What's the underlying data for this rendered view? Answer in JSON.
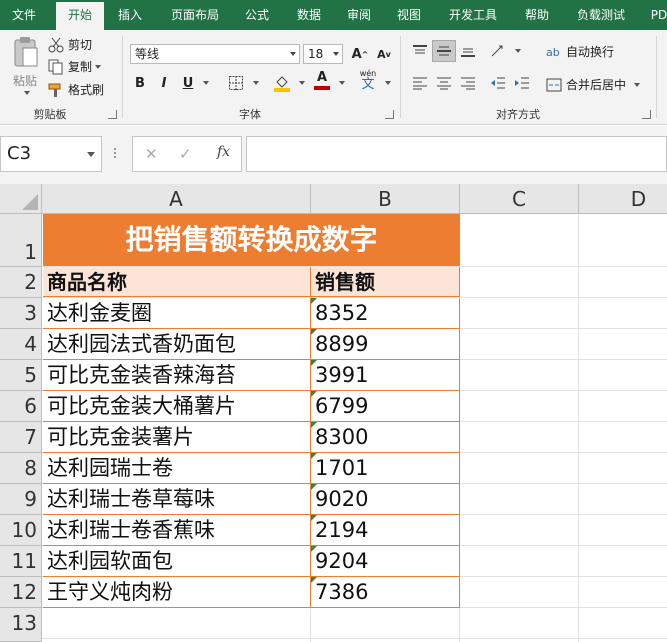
{
  "menu": {
    "tabs": [
      "文件",
      "开始",
      "插入",
      "页面布局",
      "公式",
      "数据",
      "审阅",
      "视图",
      "开发工具",
      "帮助",
      "负载测试",
      "PD"
    ],
    "active_tab": "开始"
  },
  "ribbon": {
    "clipboard": {
      "paste_label": "粘贴",
      "cut_label": "剪切",
      "copy_label": "复制",
      "format_painter_label": "格式刷",
      "group_label": "剪贴板"
    },
    "font": {
      "font_name": "等线",
      "font_size": "18",
      "increase_label": "A",
      "decrease_label": "A",
      "bold": "B",
      "italic": "I",
      "underline": "U",
      "font_color_label": "A",
      "wen_label": "wén",
      "wen_char": "文",
      "group_label": "字体"
    },
    "alignment": {
      "wrap_text_label": "自动换行",
      "merge_center_label": "合并后居中",
      "group_label": "对齐方式"
    }
  },
  "formula_bar": {
    "name_box": "C3",
    "cancel_symbol": "✕",
    "enter_symbol": "✓",
    "fx_symbol": "fx",
    "formula_value": ""
  },
  "sheet": {
    "columns": [
      "A",
      "B",
      "C",
      "D"
    ],
    "row_numbers": [
      "1",
      "2",
      "3",
      "4",
      "5",
      "6",
      "7",
      "8",
      "9",
      "10",
      "11",
      "12",
      "13"
    ],
    "title": "把销售额转换成数字",
    "header": {
      "name": "商品名称",
      "sales": "销售额"
    },
    "rows": [
      {
        "name": "达利金麦圈",
        "sales": "8352"
      },
      {
        "name": "达利园法式香奶面包",
        "sales": "8899"
      },
      {
        "name": "可比克金装香辣海苔",
        "sales": "3991"
      },
      {
        "name": "可比克金装大桶薯片",
        "sales": "6799"
      },
      {
        "name": "可比克金装薯片",
        "sales": "8300"
      },
      {
        "name": "达利园瑞士卷",
        "sales": "1701"
      },
      {
        "name": "达利瑞士卷草莓味",
        "sales": "9020"
      },
      {
        "name": "达利瑞士卷香蕉味",
        "sales": "2194"
      },
      {
        "name": "达利园软面包",
        "sales": "9204"
      },
      {
        "name": "王守义炖肉粉",
        "sales": "7386"
      }
    ]
  },
  "colors": {
    "excel_green": "#217346",
    "title_fill": "#ed7d31",
    "header_fill": "#fce4d6",
    "error_indicator": "#2e8b3a"
  }
}
